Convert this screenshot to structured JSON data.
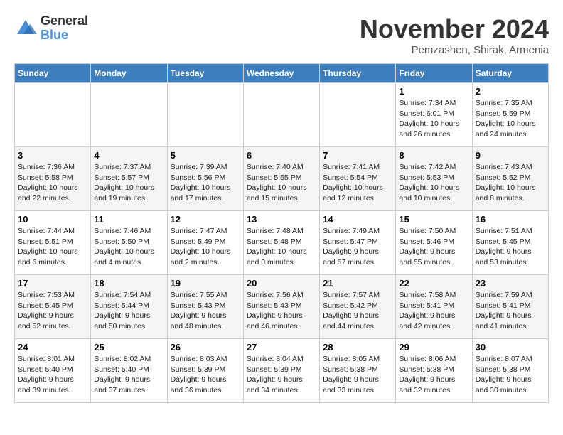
{
  "logo": {
    "text_general": "General",
    "text_blue": "Blue"
  },
  "title": "November 2024",
  "location": "Pemzashen, Shirak, Armenia",
  "days_of_week": [
    "Sunday",
    "Monday",
    "Tuesday",
    "Wednesday",
    "Thursday",
    "Friday",
    "Saturday"
  ],
  "weeks": [
    [
      {
        "day": "",
        "info": ""
      },
      {
        "day": "",
        "info": ""
      },
      {
        "day": "",
        "info": ""
      },
      {
        "day": "",
        "info": ""
      },
      {
        "day": "",
        "info": ""
      },
      {
        "day": "1",
        "info": "Sunrise: 7:34 AM\nSunset: 6:01 PM\nDaylight: 10 hours and 26 minutes."
      },
      {
        "day": "2",
        "info": "Sunrise: 7:35 AM\nSunset: 5:59 PM\nDaylight: 10 hours and 24 minutes."
      }
    ],
    [
      {
        "day": "3",
        "info": "Sunrise: 7:36 AM\nSunset: 5:58 PM\nDaylight: 10 hours and 22 minutes."
      },
      {
        "day": "4",
        "info": "Sunrise: 7:37 AM\nSunset: 5:57 PM\nDaylight: 10 hours and 19 minutes."
      },
      {
        "day": "5",
        "info": "Sunrise: 7:39 AM\nSunset: 5:56 PM\nDaylight: 10 hours and 17 minutes."
      },
      {
        "day": "6",
        "info": "Sunrise: 7:40 AM\nSunset: 5:55 PM\nDaylight: 10 hours and 15 minutes."
      },
      {
        "day": "7",
        "info": "Sunrise: 7:41 AM\nSunset: 5:54 PM\nDaylight: 10 hours and 12 minutes."
      },
      {
        "day": "8",
        "info": "Sunrise: 7:42 AM\nSunset: 5:53 PM\nDaylight: 10 hours and 10 minutes."
      },
      {
        "day": "9",
        "info": "Sunrise: 7:43 AM\nSunset: 5:52 PM\nDaylight: 10 hours and 8 minutes."
      }
    ],
    [
      {
        "day": "10",
        "info": "Sunrise: 7:44 AM\nSunset: 5:51 PM\nDaylight: 10 hours and 6 minutes."
      },
      {
        "day": "11",
        "info": "Sunrise: 7:46 AM\nSunset: 5:50 PM\nDaylight: 10 hours and 4 minutes."
      },
      {
        "day": "12",
        "info": "Sunrise: 7:47 AM\nSunset: 5:49 PM\nDaylight: 10 hours and 2 minutes."
      },
      {
        "day": "13",
        "info": "Sunrise: 7:48 AM\nSunset: 5:48 PM\nDaylight: 10 hours and 0 minutes."
      },
      {
        "day": "14",
        "info": "Sunrise: 7:49 AM\nSunset: 5:47 PM\nDaylight: 9 hours and 57 minutes."
      },
      {
        "day": "15",
        "info": "Sunrise: 7:50 AM\nSunset: 5:46 PM\nDaylight: 9 hours and 55 minutes."
      },
      {
        "day": "16",
        "info": "Sunrise: 7:51 AM\nSunset: 5:45 PM\nDaylight: 9 hours and 53 minutes."
      }
    ],
    [
      {
        "day": "17",
        "info": "Sunrise: 7:53 AM\nSunset: 5:45 PM\nDaylight: 9 hours and 52 minutes."
      },
      {
        "day": "18",
        "info": "Sunrise: 7:54 AM\nSunset: 5:44 PM\nDaylight: 9 hours and 50 minutes."
      },
      {
        "day": "19",
        "info": "Sunrise: 7:55 AM\nSunset: 5:43 PM\nDaylight: 9 hours and 48 minutes."
      },
      {
        "day": "20",
        "info": "Sunrise: 7:56 AM\nSunset: 5:43 PM\nDaylight: 9 hours and 46 minutes."
      },
      {
        "day": "21",
        "info": "Sunrise: 7:57 AM\nSunset: 5:42 PM\nDaylight: 9 hours and 44 minutes."
      },
      {
        "day": "22",
        "info": "Sunrise: 7:58 AM\nSunset: 5:41 PM\nDaylight: 9 hours and 42 minutes."
      },
      {
        "day": "23",
        "info": "Sunrise: 7:59 AM\nSunset: 5:41 PM\nDaylight: 9 hours and 41 minutes."
      }
    ],
    [
      {
        "day": "24",
        "info": "Sunrise: 8:01 AM\nSunset: 5:40 PM\nDaylight: 9 hours and 39 minutes."
      },
      {
        "day": "25",
        "info": "Sunrise: 8:02 AM\nSunset: 5:40 PM\nDaylight: 9 hours and 37 minutes."
      },
      {
        "day": "26",
        "info": "Sunrise: 8:03 AM\nSunset: 5:39 PM\nDaylight: 9 hours and 36 minutes."
      },
      {
        "day": "27",
        "info": "Sunrise: 8:04 AM\nSunset: 5:39 PM\nDaylight: 9 hours and 34 minutes."
      },
      {
        "day": "28",
        "info": "Sunrise: 8:05 AM\nSunset: 5:38 PM\nDaylight: 9 hours and 33 minutes."
      },
      {
        "day": "29",
        "info": "Sunrise: 8:06 AM\nSunset: 5:38 PM\nDaylight: 9 hours and 32 minutes."
      },
      {
        "day": "30",
        "info": "Sunrise: 8:07 AM\nSunset: 5:38 PM\nDaylight: 9 hours and 30 minutes."
      }
    ]
  ]
}
